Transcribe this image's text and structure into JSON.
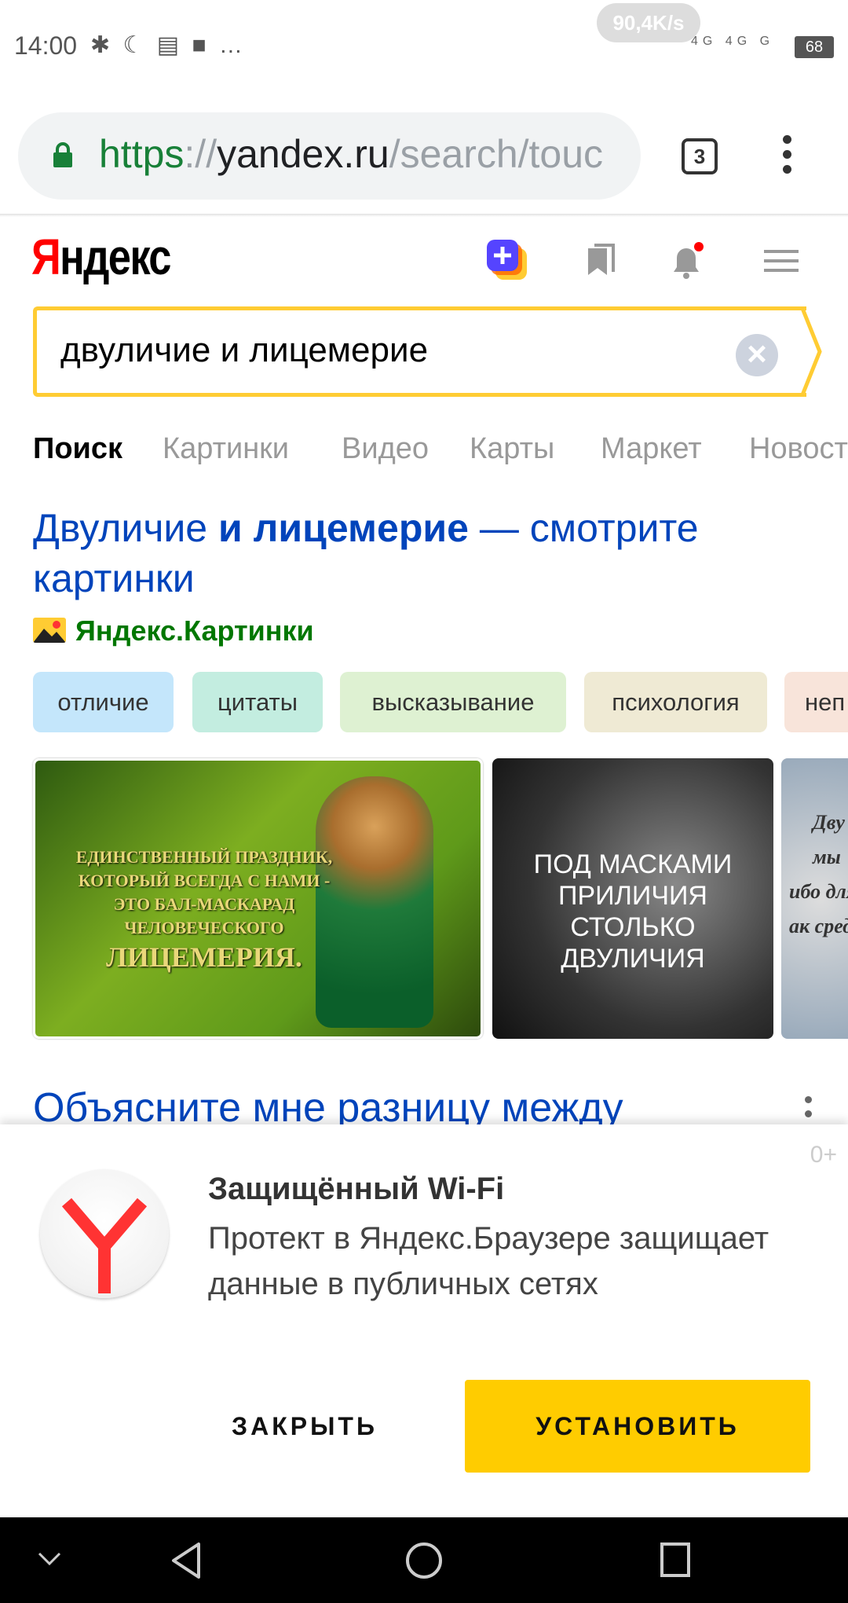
{
  "status_bar": {
    "time": "14:00",
    "icons_text": "✱ ☾ ▤ ■ …",
    "net_speed": "90,4K/s",
    "signal": "4G 4G G",
    "battery": "68"
  },
  "browser": {
    "url_scheme": "https",
    "url_sep": "://",
    "url_host": "yandex.ru",
    "url_path": "/search/touc",
    "tab_count": "3"
  },
  "header": {
    "logo_first": "Я",
    "logo_rest": "ндекс"
  },
  "search": {
    "query": "двуличие и лицемерие",
    "clear": "×"
  },
  "nav_tabs": [
    {
      "label": "Поиск",
      "active": true
    },
    {
      "label": "Картинки"
    },
    {
      "label": "Видео"
    },
    {
      "label": "Карты"
    },
    {
      "label": "Маркет"
    },
    {
      "label": "Новости"
    }
  ],
  "result1": {
    "title_part1": "Двуличие ",
    "title_bold": "и лицемерие",
    "title_part2": " — смотрите картинки",
    "source": "Яндекс.Картинки",
    "chips": [
      {
        "label": "отличие",
        "color": "#c4e6fb"
      },
      {
        "label": "цитаты",
        "color": "#c3ede0"
      },
      {
        "label": "высказывание",
        "color": "#def1d2"
      },
      {
        "label": "психология",
        "color": "#efead4"
      },
      {
        "label": "неп",
        "color": "#f8e4da"
      }
    ],
    "images": [
      {
        "lines": [
          "ЕДИНСТВЕННЫЙ ПРАЗДНИК,",
          "КОТОРЫЙ ВСЕГДА С НАМИ -",
          "ЭТО БАЛ-МАСКАРАД",
          "ЧЕЛОВЕЧЕСКОГО"
        ],
        "big": "ЛИЦЕМЕРИЯ."
      },
      {
        "lines": [
          "ПОД МАСКАМИ",
          "ПРИЛИЧИЯ",
          "СТОЛЬКО",
          "ДВУЛИЧИЯ"
        ]
      },
      {
        "lines": [
          "Дву",
          "мы",
          "ибо для",
          "ак сред"
        ]
      }
    ]
  },
  "result2": {
    "title": "Объясните мне разницу между"
  },
  "promo": {
    "age": "0+",
    "title": "Защищённый Wi-Fi",
    "body": "Протект в Яндекс.Браузере защищает данные в публичных сетях",
    "close": "ЗАКРЫТЬ",
    "install": "УСТАНОВИТЬ"
  }
}
